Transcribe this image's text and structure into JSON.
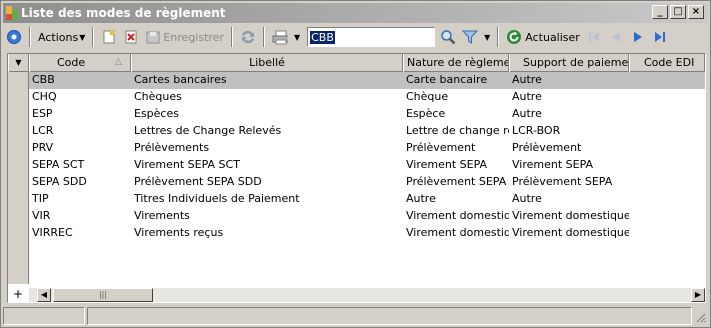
{
  "window": {
    "title": "Liste des modes de règlement",
    "buttons": {
      "minimize": "_",
      "maximize": "□",
      "close": "×"
    }
  },
  "toolbar": {
    "actions_label": "Actions",
    "save_label": "Enregistrer",
    "search_value": "CBB",
    "refresh_label": "Actualiser"
  },
  "grid": {
    "columns": [
      "Code",
      "Libellé",
      "Nature de règlement",
      "Support de paiement",
      "Code EDI"
    ],
    "rows": [
      [
        "CBB",
        "Cartes bancaires",
        "Carte bancaire",
        "Autre",
        ""
      ],
      [
        "CHQ",
        "Chèques",
        "Chèque",
        "Autre",
        ""
      ],
      [
        "ESP",
        "Espèces",
        "Espèce",
        "Autre",
        ""
      ],
      [
        "LCR",
        "Lettres de Change Relevés",
        "Lettre de change rele",
        "LCR-BOR",
        ""
      ],
      [
        "PRV",
        "Prélèvements",
        "Prélèvement",
        "Prélèvement",
        ""
      ],
      [
        "SEPA SCT",
        "Virement SEPA SCT",
        "Virement SEPA",
        "Virement SEPA",
        ""
      ],
      [
        "SEPA SDD",
        "Prélèvement SEPA SDD",
        "Prélèvement SEPA",
        "Prélèvement SEPA",
        ""
      ],
      [
        "TIP",
        "Titres Individuels de Paiement",
        "Autre",
        "Autre",
        ""
      ],
      [
        "VIR",
        "Virements",
        "Virement domestique",
        "Virement domestique",
        ""
      ],
      [
        "VIRREC",
        "Virements reçus",
        "Virement domestique",
        "Virement domestique",
        ""
      ]
    ],
    "selected_row": 0,
    "add_row_label": "+"
  },
  "colors": {
    "title_start": "#8e8e8e",
    "title_end": "#c9c9c9",
    "window_bg": "#d4d0c8",
    "selected_row": "#c0c0c0",
    "nav_blue": "#2c6cd0"
  }
}
